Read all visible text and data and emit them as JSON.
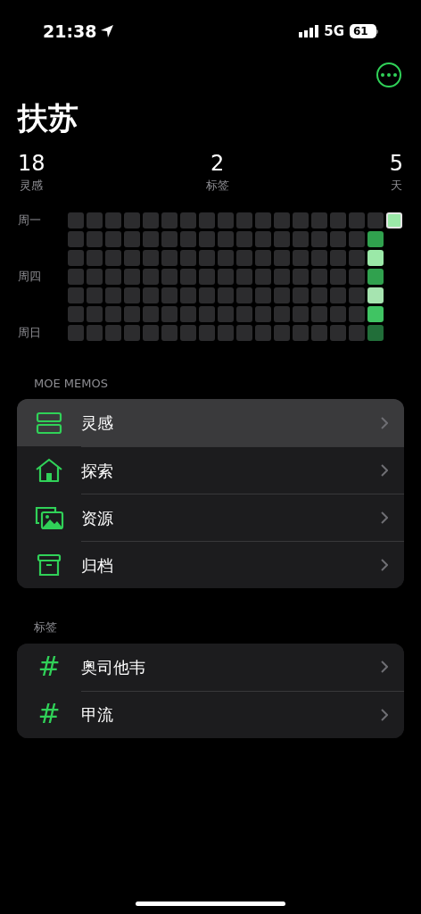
{
  "status_bar": {
    "time": "21:38",
    "network": "5G",
    "battery": "61"
  },
  "title": "扶苏",
  "stats": [
    {
      "value": "18",
      "label": "灵感"
    },
    {
      "value": "2",
      "label": "标签"
    },
    {
      "value": "5",
      "label": "天"
    }
  ],
  "heatmap": {
    "day_labels": [
      "周一",
      "周四",
      "周日"
    ],
    "weeks": [
      [
        {
          "color": "#2c2c2e"
        },
        {
          "color": "#2c2c2e"
        },
        {
          "color": "#2c2c2e"
        },
        {
          "color": "#2c2c2e"
        },
        {
          "color": "#2c2c2e"
        },
        {
          "color": "#2c2c2e"
        },
        {
          "color": "#2c2c2e"
        }
      ],
      [
        {
          "color": "#2c2c2e"
        },
        {
          "color": "#2c2c2e"
        },
        {
          "color": "#2c2c2e"
        },
        {
          "color": "#2c2c2e"
        },
        {
          "color": "#2c2c2e"
        },
        {
          "color": "#2c2c2e"
        },
        {
          "color": "#2c2c2e"
        }
      ],
      [
        {
          "color": "#2c2c2e"
        },
        {
          "color": "#2c2c2e"
        },
        {
          "color": "#2c2c2e"
        },
        {
          "color": "#2c2c2e"
        },
        {
          "color": "#2c2c2e"
        },
        {
          "color": "#2c2c2e"
        },
        {
          "color": "#2c2c2e"
        }
      ],
      [
        {
          "color": "#2c2c2e"
        },
        {
          "color": "#2c2c2e"
        },
        {
          "color": "#2c2c2e"
        },
        {
          "color": "#2c2c2e"
        },
        {
          "color": "#2c2c2e"
        },
        {
          "color": "#2c2c2e"
        },
        {
          "color": "#2c2c2e"
        }
      ],
      [
        {
          "color": "#2c2c2e"
        },
        {
          "color": "#2c2c2e"
        },
        {
          "color": "#2c2c2e"
        },
        {
          "color": "#2c2c2e"
        },
        {
          "color": "#2c2c2e"
        },
        {
          "color": "#2c2c2e"
        },
        {
          "color": "#2c2c2e"
        }
      ],
      [
        {
          "color": "#2c2c2e"
        },
        {
          "color": "#2c2c2e"
        },
        {
          "color": "#2c2c2e"
        },
        {
          "color": "#2c2c2e"
        },
        {
          "color": "#2c2c2e"
        },
        {
          "color": "#2c2c2e"
        },
        {
          "color": "#2c2c2e"
        }
      ],
      [
        {
          "color": "#2c2c2e"
        },
        {
          "color": "#2c2c2e"
        },
        {
          "color": "#2c2c2e"
        },
        {
          "color": "#2c2c2e"
        },
        {
          "color": "#2c2c2e"
        },
        {
          "color": "#2c2c2e"
        },
        {
          "color": "#2c2c2e"
        }
      ],
      [
        {
          "color": "#2c2c2e"
        },
        {
          "color": "#2c2c2e"
        },
        {
          "color": "#2c2c2e"
        },
        {
          "color": "#2c2c2e"
        },
        {
          "color": "#2c2c2e"
        },
        {
          "color": "#2c2c2e"
        },
        {
          "color": "#2c2c2e"
        }
      ],
      [
        {
          "color": "#2c2c2e"
        },
        {
          "color": "#2c2c2e"
        },
        {
          "color": "#2c2c2e"
        },
        {
          "color": "#2c2c2e"
        },
        {
          "color": "#2c2c2e"
        },
        {
          "color": "#2c2c2e"
        },
        {
          "color": "#2c2c2e"
        }
      ],
      [
        {
          "color": "#2c2c2e"
        },
        {
          "color": "#2c2c2e"
        },
        {
          "color": "#2c2c2e"
        },
        {
          "color": "#2c2c2e"
        },
        {
          "color": "#2c2c2e"
        },
        {
          "color": "#2c2c2e"
        },
        {
          "color": "#2c2c2e"
        }
      ],
      [
        {
          "color": "#2c2c2e"
        },
        {
          "color": "#2c2c2e"
        },
        {
          "color": "#2c2c2e"
        },
        {
          "color": "#2c2c2e"
        },
        {
          "color": "#2c2c2e"
        },
        {
          "color": "#2c2c2e"
        },
        {
          "color": "#2c2c2e"
        }
      ],
      [
        {
          "color": "#2c2c2e"
        },
        {
          "color": "#2c2c2e"
        },
        {
          "color": "#2c2c2e"
        },
        {
          "color": "#2c2c2e"
        },
        {
          "color": "#2c2c2e"
        },
        {
          "color": "#2c2c2e"
        },
        {
          "color": "#2c2c2e"
        }
      ],
      [
        {
          "color": "#2c2c2e"
        },
        {
          "color": "#2c2c2e"
        },
        {
          "color": "#2c2c2e"
        },
        {
          "color": "#2c2c2e"
        },
        {
          "color": "#2c2c2e"
        },
        {
          "color": "#2c2c2e"
        },
        {
          "color": "#2c2c2e"
        }
      ],
      [
        {
          "color": "#2c2c2e"
        },
        {
          "color": "#2c2c2e"
        },
        {
          "color": "#2c2c2e"
        },
        {
          "color": "#2c2c2e"
        },
        {
          "color": "#2c2c2e"
        },
        {
          "color": "#2c2c2e"
        },
        {
          "color": "#2c2c2e"
        }
      ],
      [
        {
          "color": "#2c2c2e"
        },
        {
          "color": "#2c2c2e"
        },
        {
          "color": "#2c2c2e"
        },
        {
          "color": "#2c2c2e"
        },
        {
          "color": "#2c2c2e"
        },
        {
          "color": "#2c2c2e"
        },
        {
          "color": "#2c2c2e"
        }
      ],
      [
        {
          "color": "#2c2c2e"
        },
        {
          "color": "#2c2c2e"
        },
        {
          "color": "#2c2c2e"
        },
        {
          "color": "#2c2c2e"
        },
        {
          "color": "#2c2c2e"
        },
        {
          "color": "#2c2c2e"
        },
        {
          "color": "#2c2c2e"
        }
      ],
      [
        {
          "color": "#2c2c2e"
        },
        {
          "color": "#30a14e"
        },
        {
          "color": "#9be9a8"
        },
        {
          "color": "#30a14e"
        },
        {
          "color": "#a6e4b0"
        },
        {
          "color": "#40c463"
        },
        {
          "color": "#216e39"
        }
      ],
      [
        {
          "color": "#9be9a8"
        }
      ]
    ]
  },
  "sections": [
    {
      "header": "MOE MEMOS",
      "items": [
        {
          "kind": "memos",
          "label": "灵感",
          "selected": true
        },
        {
          "kind": "explore",
          "label": "探索",
          "selected": false
        },
        {
          "kind": "resources",
          "label": "资源",
          "selected": false
        },
        {
          "kind": "archive",
          "label": "归档",
          "selected": false
        }
      ]
    },
    {
      "header": "标签",
      "items": [
        {
          "kind": "tag",
          "icon": "#",
          "label": "奥司他韦",
          "selected": false
        },
        {
          "kind": "tag",
          "icon": "#",
          "label": "甲流",
          "selected": false
        }
      ]
    }
  ]
}
